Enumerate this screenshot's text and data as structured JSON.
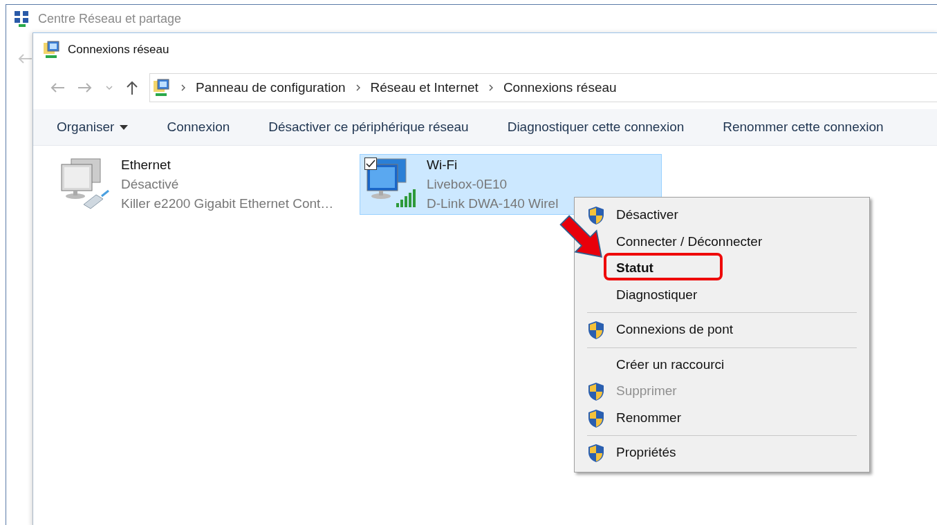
{
  "outer_window": {
    "title": "Centre Réseau et partage"
  },
  "window": {
    "title": "Connexions réseau"
  },
  "address_bar": {
    "path": [
      "Panneau de configuration",
      "Réseau et Internet",
      "Connexions réseau"
    ]
  },
  "toolbar": [
    {
      "label": "Organiser",
      "dropdown": true
    },
    {
      "label": "Connexion",
      "dropdown": false
    },
    {
      "label": "Désactiver ce périphérique réseau",
      "dropdown": false
    },
    {
      "label": "Diagnostiquer cette connexion",
      "dropdown": false
    },
    {
      "label": "Renommer cette connexion",
      "dropdown": false
    }
  ],
  "connections": [
    {
      "kind": "ethernet",
      "name": "Ethernet",
      "status": "Désactivé",
      "device": "Killer e2200 Gigabit Ethernet Cont…",
      "selected": false,
      "disabled": true
    },
    {
      "kind": "wifi",
      "name": "Wi-Fi",
      "status": "Livebox-0E10",
      "device": "D-Link DWA-140 Wirel",
      "selected": true,
      "disabled": false
    }
  ],
  "context_menu": [
    {
      "label": "Désactiver",
      "shield": true,
      "default": false,
      "disabled": false,
      "separator_after": false,
      "highlighted": false
    },
    {
      "label": "Connecter / Déconnecter",
      "shield": false,
      "default": false,
      "disabled": false,
      "separator_after": false,
      "highlighted": false
    },
    {
      "label": "Statut",
      "shield": false,
      "default": true,
      "disabled": false,
      "separator_after": false,
      "highlighted": true
    },
    {
      "label": "Diagnostiquer",
      "shield": false,
      "default": false,
      "disabled": false,
      "separator_after": true,
      "highlighted": false
    },
    {
      "label": "Connexions de pont",
      "shield": true,
      "default": false,
      "disabled": false,
      "separator_after": true,
      "highlighted": false
    },
    {
      "label": "Créer un raccourci",
      "shield": false,
      "default": false,
      "disabled": false,
      "separator_after": false,
      "highlighted": false
    },
    {
      "label": "Supprimer",
      "shield": true,
      "default": false,
      "disabled": true,
      "separator_after": false,
      "highlighted": false
    },
    {
      "label": "Renommer",
      "shield": true,
      "default": false,
      "disabled": false,
      "separator_after": true,
      "highlighted": false
    },
    {
      "label": "Propriétés",
      "shield": true,
      "default": false,
      "disabled": false,
      "separator_after": false,
      "highlighted": false
    }
  ]
}
